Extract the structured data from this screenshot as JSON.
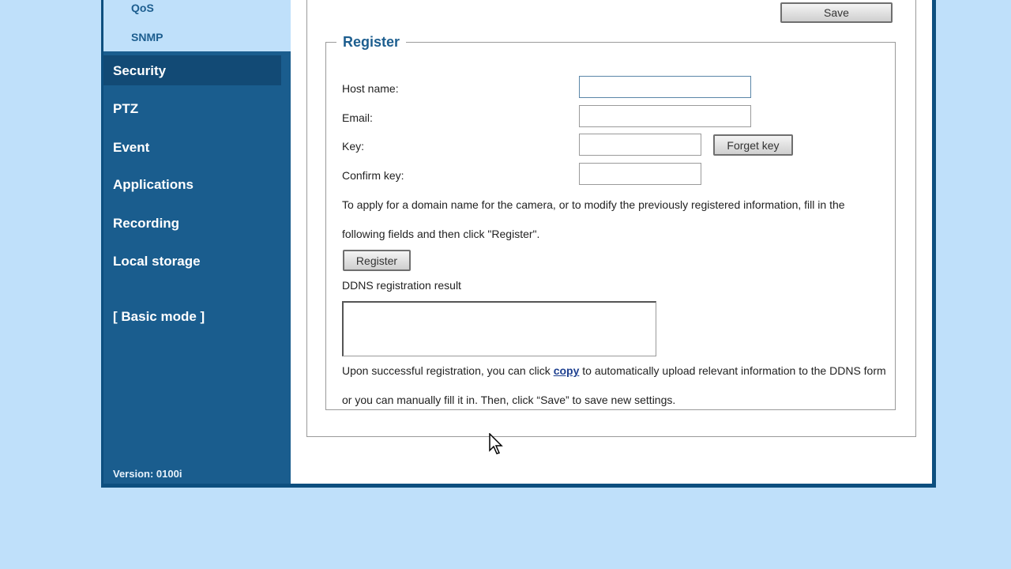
{
  "sidebar": {
    "sub_items": [
      "QoS",
      "SNMP"
    ],
    "items": [
      "Security",
      "PTZ",
      "Event",
      "Applications",
      "Recording",
      "Local storage"
    ],
    "basic_mode": "[ Basic mode ]",
    "version": "Version: 0100i"
  },
  "toolbar": {
    "save_label": "Save"
  },
  "register": {
    "legend": "Register",
    "host_label": "Host name:",
    "email_label": "Email:",
    "key_label": "Key:",
    "confirm_label": "Confirm key:",
    "forget_label": "Forget key",
    "instructions": "To apply for a domain name for the camera, or to modify the previously registered information, fill in the following fields and then click \"Register\".",
    "register_label": "Register",
    "result_label": "DDNS registration result",
    "footer_before": "Upon successful registration, you can click ",
    "copy_label": "copy",
    "footer_after": " to automatically upload relevant information to the DDNS form or you can manually fill it in. Then, click “Save” to save new settings."
  },
  "colors": {
    "page_bg": "#bfe0fa",
    "sidebar_bg": "#1a5d8e",
    "accent": "#1d5e8f"
  },
  "icons": {
    "cursor": "arrow-cursor-icon"
  }
}
